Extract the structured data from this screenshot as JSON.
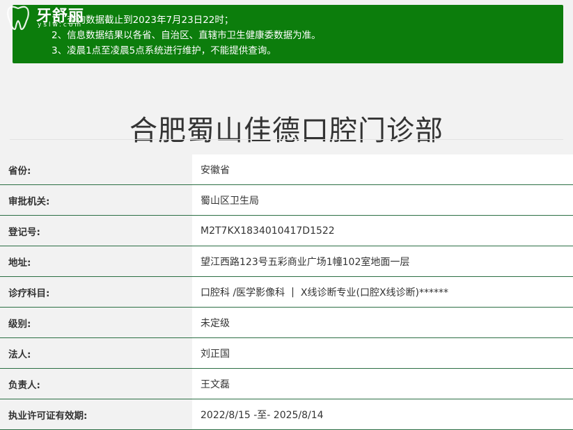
{
  "logo": {
    "name": "牙舒丽",
    "sub": "yslw.com"
  },
  "notice": {
    "lines": [
      "1、查询数据截止到2023年7月23日22时；",
      "2、信息数据结果以各省、自治区、直辖市卫生健康委数据为准。",
      "3、凌晨1点至凌晨5点系统进行维护，不能提供查询。"
    ]
  },
  "title": "合肥蜀山佳德口腔门诊部",
  "rows": [
    {
      "label": "省份:",
      "value": "安徽省"
    },
    {
      "label": "审批机关:",
      "value": "蜀山区卫生局"
    },
    {
      "label": "登记号:",
      "value": "M2T7KX1834010417D1522"
    },
    {
      "label": "地址:",
      "value": "望江西路123号五彩商业广场1幢102室地面一层"
    },
    {
      "label": "诊疗科目:",
      "value_parts": [
        "口腔科 /医学影像科",
        "|",
        "X线诊断专业(口腔X线诊断)******"
      ]
    },
    {
      "label": "级别:",
      "value": "未定级"
    },
    {
      "label": "法人:",
      "value": "刘正国"
    },
    {
      "label": "负责人:",
      "value": "王文磊"
    },
    {
      "label": "执业许可证有效期:",
      "value": "2022/8/15 -至- 2025/8/14"
    }
  ],
  "colors": {
    "notice_bg": "#0c7d0c",
    "row_border": "#2a6e43"
  }
}
